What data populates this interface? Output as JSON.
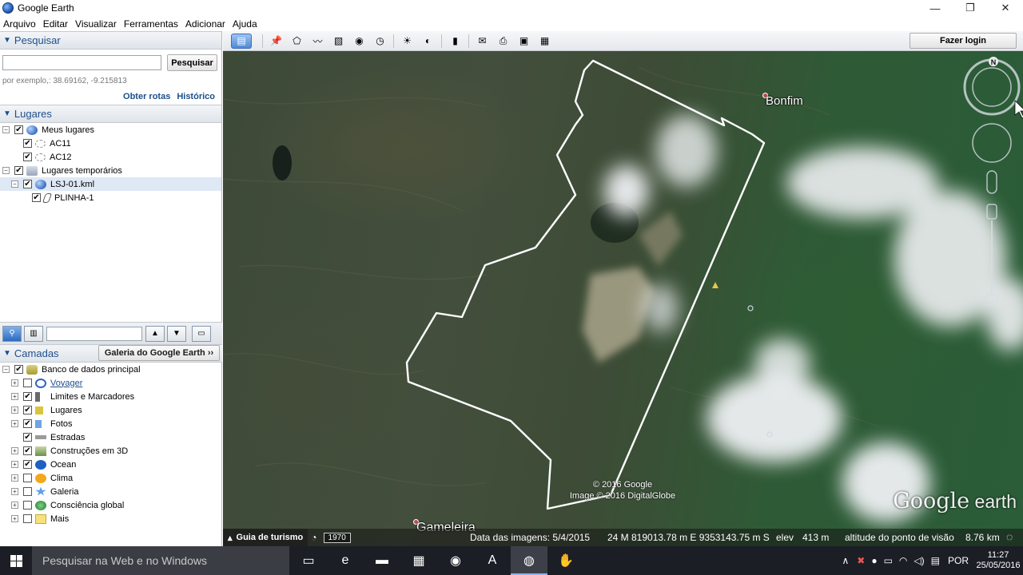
{
  "window": {
    "title": "Google Earth",
    "controls": [
      "—",
      "❐",
      "✕"
    ]
  },
  "menu": [
    "Arquivo",
    "Editar",
    "Visualizar",
    "Ferramentas",
    "Adicionar",
    "Ajuda"
  ],
  "search": {
    "header": "Pesquisar",
    "button": "Pesquisar",
    "input_value": "",
    "hint": "por exemplo,: 38.69162, -9.215813",
    "link_routes": "Obter rotas",
    "link_history": "Histórico"
  },
  "places": {
    "header": "Lugares",
    "items": [
      {
        "label": "Meus lugares",
        "level": 0,
        "expand": "−",
        "checked": "✔",
        "icon": "globe-icon",
        "selected": false
      },
      {
        "label": "AC11",
        "level": 1,
        "expand": "",
        "checked": "✔",
        "icon": "pin-icon",
        "selected": false
      },
      {
        "label": "AC12",
        "level": 1,
        "expand": "",
        "checked": "✔",
        "icon": "pin-icon",
        "selected": false
      },
      {
        "label": "Lugares temporários",
        "level": 0,
        "expand": "−",
        "checked": "✔",
        "icon": "folder-icon",
        "selected": false
      },
      {
        "label": "LSJ-01.kml",
        "level": 1,
        "expand": "−",
        "checked": "✔",
        "icon": "globe-icon",
        "selected": true
      },
      {
        "label": "PLINHA-1",
        "level": 2,
        "expand": "",
        "checked": "✔",
        "icon": "path-icon",
        "selected": false
      }
    ]
  },
  "layers": {
    "header": "Camadas",
    "gallery_button": "Galeria do Google Earth  ››",
    "items": [
      {
        "label": "Banco de dados principal",
        "level": 0,
        "expand": "−",
        "checked": "✔",
        "icon": "database-icon",
        "link": false
      },
      {
        "label": "Voyager",
        "level": 1,
        "expand": "+",
        "checked": "",
        "icon": "voyager-icon",
        "link": true
      },
      {
        "label": "Limites e Marcadores",
        "level": 1,
        "expand": "+",
        "checked": "✔",
        "icon": "borders-icon",
        "link": false
      },
      {
        "label": "Lugares",
        "level": 1,
        "expand": "+",
        "checked": "✔",
        "icon": "places-icon",
        "link": false
      },
      {
        "label": "Fotos",
        "level": 1,
        "expand": "+",
        "checked": "✔",
        "icon": "photos-icon",
        "link": false
      },
      {
        "label": "Estradas",
        "level": 1,
        "expand": "",
        "checked": "✔",
        "icon": "roads-icon",
        "link": false
      },
      {
        "label": "Construções em 3D",
        "level": 1,
        "expand": "+",
        "checked": "✔",
        "icon": "buildings-icon",
        "link": false
      },
      {
        "label": "Ocean",
        "level": 1,
        "expand": "+",
        "checked": "✔",
        "icon": "ocean-icon",
        "link": false
      },
      {
        "label": "Clima",
        "level": 1,
        "expand": "+",
        "checked": "",
        "icon": "weather-icon",
        "link": false
      },
      {
        "label": "Galeria",
        "level": 1,
        "expand": "+",
        "checked": "",
        "icon": "gallery-icon",
        "link": false
      },
      {
        "label": "Consciência global",
        "level": 1,
        "expand": "+",
        "checked": "",
        "icon": "global-awareness-icon",
        "link": false
      },
      {
        "label": "Mais",
        "level": 1,
        "expand": "+",
        "checked": "",
        "icon": "more-icon",
        "link": false
      }
    ]
  },
  "toolbar": {
    "tools": [
      {
        "name": "sidebar-toggle-icon",
        "glyph": "▤",
        "active": true
      },
      {
        "name": "placemark-icon",
        "glyph": "📌"
      },
      {
        "name": "polygon-icon",
        "glyph": "⬠"
      },
      {
        "name": "path-icon",
        "glyph": "〰"
      },
      {
        "name": "overlay-icon",
        "glyph": "▧"
      },
      {
        "name": "record-tour-icon",
        "glyph": "◉"
      },
      {
        "name": "historical-imagery-icon",
        "glyph": "◷"
      },
      {
        "name": "sunlight-icon",
        "glyph": "☀"
      },
      {
        "name": "planets-icon",
        "glyph": "◐"
      },
      {
        "name": "ruler-icon",
        "glyph": "▮"
      },
      {
        "name": "email-icon",
        "glyph": "✉"
      },
      {
        "name": "print-icon",
        "glyph": "⎙"
      },
      {
        "name": "save-image-icon",
        "glyph": "▣"
      },
      {
        "name": "view-in-maps-icon",
        "glyph": "▦"
      }
    ],
    "login": "Fazer login"
  },
  "map": {
    "labels": [
      {
        "text": "Bonfim"
      },
      {
        "text": "Gameleira"
      }
    ],
    "copyright_lines": [
      "© 2016 Google",
      "Image © 2016 DigitalGlobe"
    ],
    "logo_main": "Google",
    "logo_sub": " earth",
    "compass_letter": "N",
    "colors": {
      "boundary": "#ffffff",
      "land": "#3e4a38",
      "forest": "#2a5d38",
      "cloud": "#e9ecef"
    }
  },
  "status": {
    "tour": "Guia de turismo",
    "year": "1970",
    "image_date": "Data das imagens: 5/4/2015",
    "coords": "24 M 819013.78 m E 9353143.75 m S",
    "elev_label": "elev",
    "elev_value": "413 m",
    "eye_label": "altitude do ponto de visão",
    "eye_value": "8.76 km"
  },
  "taskbar": {
    "search_placeholder": "Pesquisar na Web e no Windows",
    "apps": [
      {
        "name": "task-view-icon",
        "glyph": "▭",
        "active": false
      },
      {
        "name": "edge-icon",
        "glyph": "e",
        "active": false
      },
      {
        "name": "explorer-icon",
        "glyph": "▬",
        "active": false
      },
      {
        "name": "store-icon",
        "glyph": "▦",
        "active": false
      },
      {
        "name": "firefox-icon",
        "glyph": "◉",
        "active": false
      },
      {
        "name": "acrobat-icon",
        "glyph": "A",
        "active": false
      },
      {
        "name": "google-earth-icon",
        "glyph": "◍",
        "active": true
      },
      {
        "name": "app-icon",
        "glyph": "✋",
        "active": false
      }
    ],
    "lang": "POR",
    "time": "11:27",
    "date": "25/05/2016"
  }
}
